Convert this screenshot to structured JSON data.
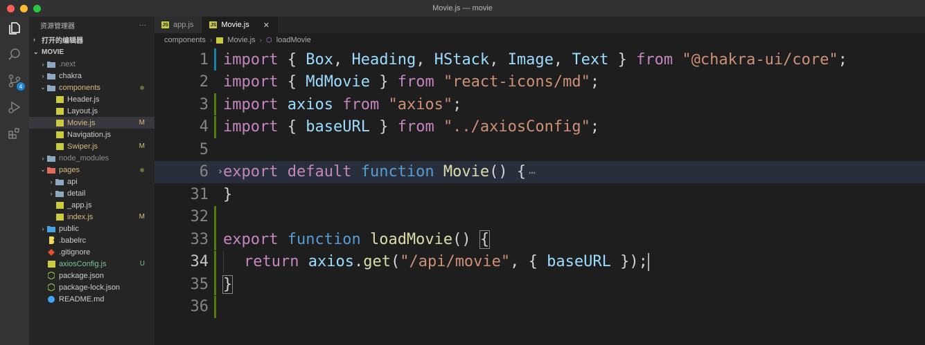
{
  "window": {
    "title": "Movie.js — movie",
    "traffic_colors": [
      "#ff5f57",
      "#febc2e",
      "#28c840"
    ]
  },
  "activity_bar": {
    "items": [
      "explorer-icon",
      "search-icon",
      "source-control-icon",
      "run-debug-icon",
      "extensions-icon"
    ],
    "scm_badge": "4"
  },
  "sidebar": {
    "header": "资源管理器",
    "more": "···",
    "open_editors": "打开的编辑器",
    "root": "MOVIE",
    "tree": [
      {
        "label": ".next",
        "depth": 1,
        "type": "folder",
        "open": false,
        "dim": true
      },
      {
        "label": "chakra",
        "depth": 1,
        "type": "folder",
        "open": false
      },
      {
        "label": "components",
        "depth": 1,
        "type": "folder",
        "open": true,
        "modified": true,
        "dot": true
      },
      {
        "label": "Header.js",
        "depth": 2,
        "type": "js"
      },
      {
        "label": "Layout.js",
        "depth": 2,
        "type": "js"
      },
      {
        "label": "Movie.js",
        "depth": 2,
        "type": "js",
        "modified": true,
        "status": "M",
        "selected": true
      },
      {
        "label": "Navigation.js",
        "depth": 2,
        "type": "js"
      },
      {
        "label": "Swiper.js",
        "depth": 2,
        "type": "js",
        "modified": true,
        "status": "M"
      },
      {
        "label": "node_modules",
        "depth": 1,
        "type": "folder",
        "open": false,
        "dim": true
      },
      {
        "label": "pages",
        "depth": 1,
        "type": "folder-red",
        "open": true,
        "modified": true,
        "dot": true
      },
      {
        "label": "api",
        "depth": 2,
        "type": "folder",
        "open": false
      },
      {
        "label": "detail",
        "depth": 2,
        "type": "folder",
        "open": false
      },
      {
        "label": "_app.js",
        "depth": 2,
        "type": "js"
      },
      {
        "label": "index.js",
        "depth": 2,
        "type": "js",
        "modified": true,
        "status": "M"
      },
      {
        "label": "public",
        "depth": 1,
        "type": "folder-blue",
        "open": false
      },
      {
        "label": ".babelrc",
        "depth": 1,
        "type": "babel"
      },
      {
        "label": ".gitignore",
        "depth": 1,
        "type": "git"
      },
      {
        "label": "axiosConfig.js",
        "depth": 1,
        "type": "js",
        "untracked": true,
        "status": "U"
      },
      {
        "label": "package.json",
        "depth": 1,
        "type": "node"
      },
      {
        "label": "package-lock.json",
        "depth": 1,
        "type": "node"
      },
      {
        "label": "README.md",
        "depth": 1,
        "type": "info"
      }
    ]
  },
  "tabs": [
    {
      "label": "app.js",
      "active": false
    },
    {
      "label": "Movie.js",
      "active": true,
      "close": "✕"
    }
  ],
  "breadcrumbs": [
    "components",
    "Movie.js",
    "loadMovie"
  ],
  "code": [
    {
      "num": "1",
      "gutter": "mod",
      "tokens": [
        [
          "kw",
          "import"
        ],
        [
          "ct",
          " { "
        ],
        [
          "id",
          "Box"
        ],
        [
          "ct",
          ", "
        ],
        [
          "id",
          "Heading"
        ],
        [
          "ct",
          ", "
        ],
        [
          "id",
          "HStack"
        ],
        [
          "ct",
          ", "
        ],
        [
          "id",
          "Image"
        ],
        [
          "ct",
          ", "
        ],
        [
          "id",
          "Text"
        ],
        [
          "ct",
          " } "
        ],
        [
          "kw",
          "from"
        ],
        [
          "ct",
          " "
        ],
        [
          "str",
          "\"@chakra-ui/core\""
        ],
        [
          "ct",
          ";"
        ]
      ]
    },
    {
      "num": "2",
      "gutter": "",
      "tokens": [
        [
          "kw",
          "import"
        ],
        [
          "ct",
          " { "
        ],
        [
          "id",
          "MdMovie"
        ],
        [
          "ct",
          " } "
        ],
        [
          "kw",
          "from"
        ],
        [
          "ct",
          " "
        ],
        [
          "str",
          "\"react-icons/md\""
        ],
        [
          "ct",
          ";"
        ]
      ]
    },
    {
      "num": "3",
      "gutter": "add",
      "tokens": [
        [
          "kw",
          "import"
        ],
        [
          "ct",
          " "
        ],
        [
          "id",
          "axios"
        ],
        [
          "ct",
          " "
        ],
        [
          "kw",
          "from"
        ],
        [
          "ct",
          " "
        ],
        [
          "str",
          "\"axios\""
        ],
        [
          "ct",
          ";"
        ]
      ]
    },
    {
      "num": "4",
      "gutter": "add",
      "tokens": [
        [
          "kw",
          "import"
        ],
        [
          "ct",
          " { "
        ],
        [
          "id",
          "baseURL"
        ],
        [
          "ct",
          " } "
        ],
        [
          "kw",
          "from"
        ],
        [
          "ct",
          " "
        ],
        [
          "str",
          "\"../axiosConfig\""
        ],
        [
          "ct",
          ";"
        ]
      ]
    },
    {
      "num": "5",
      "gutter": "",
      "tokens": []
    },
    {
      "num": "6",
      "gutter": "",
      "fold": "›",
      "highlight": true,
      "tokens": [
        [
          "kw",
          "export"
        ],
        [
          "ct",
          " "
        ],
        [
          "kw",
          "default"
        ],
        [
          "ct",
          " "
        ],
        [
          "kw2",
          "function"
        ],
        [
          "ct",
          " "
        ],
        [
          "fn",
          "Movie"
        ],
        [
          "ct",
          "() {"
        ]
      ],
      "ellipsis": "⋯"
    },
    {
      "num": "31",
      "gutter": "",
      "tokens": [
        [
          "ct",
          "}"
        ]
      ]
    },
    {
      "num": "32",
      "gutter": "add",
      "tokens": []
    },
    {
      "num": "33",
      "gutter": "add",
      "tokens": [
        [
          "kw",
          "export"
        ],
        [
          "ct",
          " "
        ],
        [
          "kw2",
          "function"
        ],
        [
          "ct",
          " "
        ],
        [
          "fn",
          "loadMovie"
        ],
        [
          "ct",
          "() "
        ],
        [
          "box",
          "{"
        ]
      ]
    },
    {
      "num": "34",
      "gutter": "add",
      "current": true,
      "indent": true,
      "cursor": true,
      "tokens": [
        [
          "kw",
          "return"
        ],
        [
          "ct",
          " "
        ],
        [
          "id",
          "axios"
        ],
        [
          "ct",
          "."
        ],
        [
          "fn",
          "get"
        ],
        [
          "ct",
          "("
        ],
        [
          "str",
          "\"/api/movie\""
        ],
        [
          "ct",
          ", { "
        ],
        [
          "id",
          "baseURL"
        ],
        [
          "ct",
          " });"
        ]
      ]
    },
    {
      "num": "35",
      "gutter": "add",
      "tokens": [
        [
          "box",
          "}"
        ]
      ]
    },
    {
      "num": "36",
      "gutter": "add",
      "tokens": []
    }
  ]
}
